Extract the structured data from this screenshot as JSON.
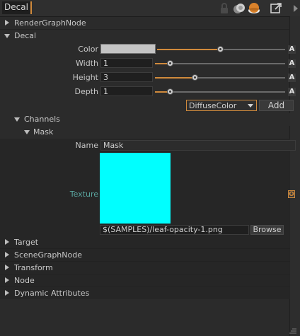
{
  "header": {
    "title": "Decal"
  },
  "sections": {
    "render_graph_node": "RenderGraphNode",
    "decal": "Decal",
    "target": "Target",
    "scene_graph_node": "SceneGraphNode",
    "transform": "Transform",
    "node": "Node",
    "dynamic_attributes": "Dynamic Attributes"
  },
  "decal": {
    "color_label": "Color",
    "color_value": "#c4c4c4",
    "color_slider": 0.48,
    "width_label": "Width",
    "width_value": "1",
    "width_slider": 0.09,
    "height_label": "Height",
    "height_value": "3",
    "height_slider": 0.31,
    "depth_label": "Depth",
    "depth_value": "1",
    "depth_slider": 0.09,
    "auto_label": "A",
    "layer_select": "DiffuseColor",
    "add_label": "Add"
  },
  "channels": {
    "label": "Channels",
    "mask": {
      "label": "Mask",
      "name_label": "Name",
      "name_value": "Mask",
      "texture_label": "Texture",
      "texture_color": "#00ffff",
      "texture_path": "$(SAMPLES)/leaf-opacity-1.png",
      "browse_label": "Browse",
      "o_label": "O"
    }
  },
  "colors": {
    "accent": "#d08a3c",
    "texture_label": "#5aa6a0"
  }
}
